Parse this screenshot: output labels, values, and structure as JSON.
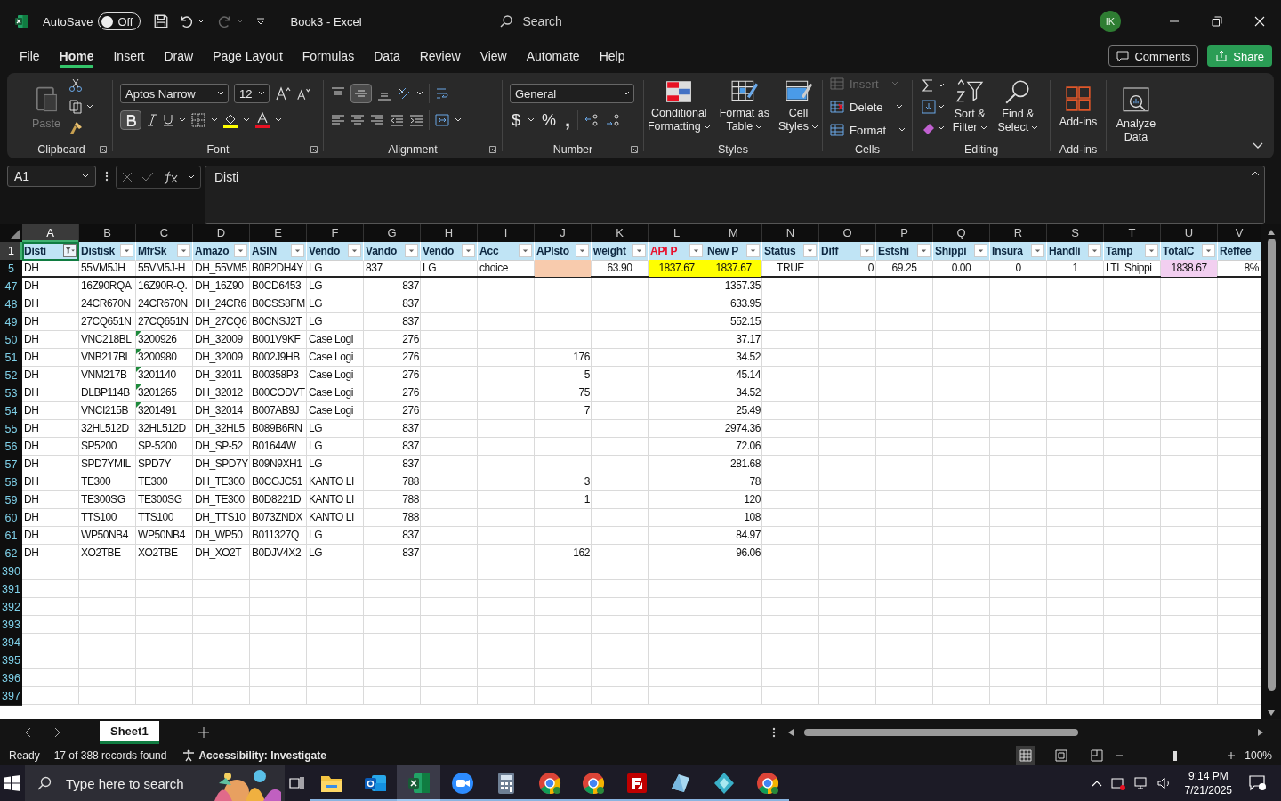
{
  "title_bar": {
    "autosave_label": "AutoSave",
    "autosave_on": false,
    "autosave_state": "Off",
    "title": "Book3 - Excel",
    "search_placeholder": "Search",
    "avatar": "IK"
  },
  "menu_tabs": [
    {
      "label": "File",
      "selected": false
    },
    {
      "label": "Home",
      "selected": true
    },
    {
      "label": "Insert",
      "selected": false
    },
    {
      "label": "Draw",
      "selected": false
    },
    {
      "label": "Page Layout",
      "selected": false
    },
    {
      "label": "Formulas",
      "selected": false
    },
    {
      "label": "Data",
      "selected": false
    },
    {
      "label": "Review",
      "selected": false
    },
    {
      "label": "View",
      "selected": false
    },
    {
      "label": "Automate",
      "selected": false
    },
    {
      "label": "Help",
      "selected": false
    }
  ],
  "comments": "Comments",
  "share": "Share",
  "ribbon": {
    "clipboard": {
      "label": "Clipboard",
      "paste": "Paste",
      "paste_disabled": true
    },
    "font": {
      "label": "Font",
      "family": "Aptos Narrow",
      "size": "12",
      "bold": true
    },
    "alignment": {
      "label": "Alignment",
      "middle_align": true
    },
    "number": {
      "label": "Number",
      "format": "General",
      "currency": "$",
      "percent": "%",
      "comma": ","
    },
    "styles": {
      "label": "Styles",
      "buttons": [
        {
          "lines": [
            "Conditional",
            "Formatting"
          ]
        },
        {
          "lines": [
            "Format as",
            "Table"
          ]
        },
        {
          "lines": [
            "Cell",
            "Styles"
          ]
        }
      ]
    },
    "cells": {
      "label": "Cells",
      "items": [
        {
          "label": "Insert",
          "disabled": true
        },
        {
          "label": "Delete",
          "disabled": false
        },
        {
          "label": "Format",
          "disabled": false
        }
      ]
    },
    "editing": {
      "label": "Editing",
      "buttons": [
        {
          "lines": [
            "Sort &",
            "Filter"
          ]
        },
        {
          "lines": [
            "Find &",
            "Select"
          ]
        }
      ]
    },
    "addins": {
      "label": "Add-ins",
      "button": "Add-ins"
    },
    "analyze": {
      "lines": [
        "Analyze",
        "Data"
      ]
    }
  },
  "formula_bar": {
    "name_box": "A1",
    "formula": "Disti"
  },
  "columns": [
    {
      "letter": "A",
      "selected": true
    },
    {
      "letter": "B",
      "selected": false
    },
    {
      "letter": "C",
      "selected": false
    },
    {
      "letter": "D",
      "selected": false
    },
    {
      "letter": "E",
      "selected": false
    },
    {
      "letter": "F",
      "selected": false
    },
    {
      "letter": "G",
      "selected": false
    },
    {
      "letter": "H",
      "selected": false
    },
    {
      "letter": "I",
      "selected": false
    },
    {
      "letter": "J",
      "selected": false
    },
    {
      "letter": "K",
      "selected": false
    },
    {
      "letter": "L",
      "selected": false
    },
    {
      "letter": "M",
      "selected": false
    },
    {
      "letter": "N",
      "selected": false
    },
    {
      "letter": "O",
      "selected": false
    },
    {
      "letter": "P",
      "selected": false
    },
    {
      "letter": "Q",
      "selected": false
    },
    {
      "letter": "R",
      "selected": false
    },
    {
      "letter": "S",
      "selected": false
    },
    {
      "letter": "T",
      "selected": false
    },
    {
      "letter": "U",
      "selected": false
    },
    {
      "letter": "V",
      "selected": false
    }
  ],
  "header_row": {
    "number": "1",
    "selected": true,
    "cells": [
      {
        "text": "Disti",
        "filter_button": true,
        "filtered": true,
        "active": true,
        "color": "#0e2841"
      },
      {
        "text": "Distisk",
        "filter_button": true,
        "filtered": false,
        "active": false,
        "color": "#0e2841"
      },
      {
        "text": "MfrSk",
        "filter_button": true,
        "filtered": false,
        "active": false,
        "color": "#0e2841"
      },
      {
        "text": "Amazo",
        "filter_button": true,
        "filtered": false,
        "active": false,
        "color": "#0e2841"
      },
      {
        "text": "ASIN",
        "filter_button": true,
        "filtered": false,
        "active": false,
        "color": "#0e2841"
      },
      {
        "text": "Vendo",
        "filter_button": true,
        "filtered": false,
        "active": false,
        "color": "#0e2841"
      },
      {
        "text": "Vando",
        "filter_button": true,
        "filtered": false,
        "active": false,
        "color": "#0e2841"
      },
      {
        "text": "Vendo",
        "filter_button": true,
        "filtered": false,
        "active": false,
        "color": "#0e2841"
      },
      {
        "text": "Acc",
        "filter_button": true,
        "filtered": false,
        "active": false,
        "color": "#0e2841"
      },
      {
        "text": "APIsto",
        "filter_button": true,
        "filtered": false,
        "active": false,
        "color": "#0e2841"
      },
      {
        "text": "weight",
        "filter_button": true,
        "filtered": false,
        "active": false,
        "color": "#0e2841"
      },
      {
        "text": "API P",
        "filter_button": true,
        "filtered": false,
        "active": false,
        "color": "#e8112d"
      },
      {
        "text": "New P",
        "filter_button": true,
        "filtered": false,
        "active": false,
        "color": "#0e2841"
      },
      {
        "text": "Status",
        "filter_button": true,
        "filtered": false,
        "active": false,
        "color": "#0e2841"
      },
      {
        "text": "Diff",
        "filter_button": true,
        "filtered": false,
        "active": false,
        "color": "#0e2841"
      },
      {
        "text": "Estshi",
        "filter_button": true,
        "filtered": false,
        "active": false,
        "color": "#0e2841"
      },
      {
        "text": "Shippi",
        "filter_button": true,
        "filtered": false,
        "active": false,
        "color": "#0e2841"
      },
      {
        "text": "Insura",
        "filter_button": true,
        "filtered": false,
        "active": false,
        "color": "#0e2841"
      },
      {
        "text": "Handli",
        "filter_button": true,
        "filtered": false,
        "active": false,
        "color": "#0e2841"
      },
      {
        "text": "Tamp",
        "filter_button": true,
        "filtered": false,
        "active": false,
        "color": "#0e2841"
      },
      {
        "text": "TotalC",
        "filter_button": true,
        "filtered": false,
        "active": false,
        "color": "#0e2841"
      },
      {
        "text": "Reffee",
        "filter_button": false,
        "active": false,
        "color": "#0e2841"
      }
    ]
  },
  "rows": [
    {
      "number": "5",
      "kind": "frozen",
      "flag": false,
      "cells": [
        {
          "text": "DH"
        },
        {
          "text": "55VM5JH"
        },
        {
          "text": "55VM5J-H"
        },
        {
          "text": "DH_55VM5"
        },
        {
          "text": "B0B2DH4Y"
        },
        {
          "text": "LG"
        },
        {
          "text": "837"
        },
        {
          "text": "LG"
        },
        {
          "text": "choice"
        },
        {
          "color": "#f8cbad"
        },
        {
          "text": "63.90"
        },
        {
          "text": "1837.67",
          "color": "#ffff00"
        },
        {
          "text": "1837.67",
          "color": "#ffff00"
        },
        {
          "text": "TRUE"
        },
        {
          "text": "0"
        },
        {
          "text": "69.25"
        },
        {
          "text": "0.00"
        },
        {
          "text": "0"
        },
        {
          "text": "1"
        },
        {
          "text": "LTL Shippi"
        },
        {
          "text": "1838.67",
          "color": "#f2cff0"
        },
        {
          "text": "8%"
        }
      ]
    },
    {
      "number": "47",
      "kind": "data",
      "flag": false,
      "cells": [
        "DH",
        "16Z90RQA",
        "16Z90R-Q.",
        "DH_16Z90",
        "B0CD6453",
        "LG",
        "837",
        null,
        null,
        null,
        null,
        null,
        "1357.35"
      ]
    },
    {
      "number": "48",
      "kind": "data",
      "flag": false,
      "cells": [
        "DH",
        "24CR670N",
        "24CR670N",
        "DH_24CR6",
        "B0CSS8FM",
        "LG",
        "837",
        null,
        null,
        null,
        null,
        null,
        "633.95"
      ]
    },
    {
      "number": "49",
      "kind": "data",
      "flag": false,
      "cells": [
        "DH",
        "27CQ651N",
        "27CQ651N",
        "DH_27CQ6",
        "B0CNSJ2T",
        "LG",
        "837",
        null,
        null,
        null,
        null,
        null,
        "552.15"
      ]
    },
    {
      "number": "50",
      "kind": "data",
      "flag": true,
      "cells": [
        "DH",
        "VNC218BL",
        "3200926",
        "DH_32009",
        "B001V9KF",
        "Case Logi",
        "276",
        null,
        null,
        null,
        null,
        null,
        "37.17"
      ]
    },
    {
      "number": "51",
      "kind": "data",
      "flag": true,
      "cells": [
        "DH",
        "VNB217BL",
        "3200980",
        "DH_32009",
        "B002J9HB",
        "Case Logi",
        "276",
        null,
        null,
        "176",
        null,
        null,
        "34.52"
      ]
    },
    {
      "number": "52",
      "kind": "data",
      "flag": true,
      "cells": [
        "DH",
        "VNM217B",
        "3201140",
        "DH_32011",
        "B00358P3",
        "Case Logi",
        "276",
        null,
        null,
        "5",
        null,
        null,
        "45.14"
      ]
    },
    {
      "number": "53",
      "kind": "data",
      "flag": true,
      "cells": [
        "DH",
        "DLBP114B",
        "3201265",
        "DH_32012",
        "B00CODVT",
        "Case Logi",
        "276",
        null,
        null,
        "75",
        null,
        null,
        "34.52"
      ]
    },
    {
      "number": "54",
      "kind": "data",
      "flag": true,
      "cells": [
        "DH",
        "VNCI215B",
        "3201491",
        "DH_32014",
        "B007AB9J",
        "Case Logi",
        "276",
        null,
        null,
        "7",
        null,
        null,
        "25.49"
      ]
    },
    {
      "number": "55",
      "kind": "data",
      "flag": false,
      "cells": [
        "DH",
        "32HL512D",
        "32HL512D",
        "DH_32HL5",
        "B089B6RN",
        "LG",
        "837",
        null,
        null,
        null,
        null,
        null,
        "2974.36"
      ]
    },
    {
      "number": "56",
      "kind": "data",
      "flag": false,
      "cells": [
        "DH",
        "SP5200",
        "SP-5200",
        "DH_SP-52",
        "B01644W",
        "LG",
        "837",
        null,
        null,
        null,
        null,
        null,
        "72.06"
      ]
    },
    {
      "number": "57",
      "kind": "data",
      "flag": false,
      "cells": [
        "DH",
        "SPD7YMIL",
        "SPD7Y",
        "DH_SPD7Y",
        "B09N9XH1",
        "LG",
        "837",
        null,
        null,
        null,
        null,
        null,
        "281.68"
      ]
    },
    {
      "number": "58",
      "kind": "data",
      "flag": false,
      "cells": [
        "DH",
        "TE300",
        "TE300",
        "DH_TE300",
        "B0CGJC51",
        "KANTO LI",
        "788",
        null,
        null,
        "3",
        null,
        null,
        "78"
      ]
    },
    {
      "number": "59",
      "kind": "data",
      "flag": false,
      "cells": [
        "DH",
        "TE300SG",
        "TE300SG",
        "DH_TE300",
        "B0D8221D",
        "KANTO LI",
        "788",
        null,
        null,
        "1",
        null,
        null,
        "120"
      ]
    },
    {
      "number": "60",
      "kind": "data",
      "flag": false,
      "cells": [
        "DH",
        "TTS100",
        "TTS100",
        "DH_TTS10",
        "B073ZNDX",
        "KANTO LI",
        "788",
        null,
        null,
        null,
        null,
        null,
        "108"
      ]
    },
    {
      "number": "61",
      "kind": "data",
      "flag": false,
      "cells": [
        "DH",
        "WP50NB4",
        "WP50NB4",
        "DH_WP50",
        "B011327Q",
        "LG",
        "837",
        null,
        null,
        null,
        null,
        null,
        "84.97"
      ]
    },
    {
      "number": "62",
      "kind": "data",
      "flag": false,
      "cells": [
        "DH",
        "XO2TBE",
        "XO2TBE",
        "DH_XO2T",
        "B0DJV4X2",
        "LG",
        "837",
        null,
        null,
        "162",
        null,
        null,
        "96.06"
      ]
    },
    {
      "number": "390",
      "kind": "data",
      "flag": false
    },
    {
      "number": "391",
      "kind": "data",
      "flag": false
    },
    {
      "number": "392",
      "kind": "data",
      "flag": false
    },
    {
      "number": "393",
      "kind": "data",
      "flag": false
    },
    {
      "number": "394",
      "kind": "data",
      "flag": false
    },
    {
      "number": "395",
      "kind": "data",
      "flag": false
    },
    {
      "number": "396",
      "kind": "data",
      "flag": false
    },
    {
      "number": "397",
      "kind": "data",
      "flag": false
    }
  ],
  "sheet_tabs": [
    {
      "label": "Sheet1",
      "selected": true
    }
  ],
  "status_bar": {
    "ready": "Ready",
    "records": "17 of 388 records found",
    "accessibility": "Accessibility: Investigate",
    "zoom": "100%",
    "zoom_slider": {
      "level": 0.5
    }
  },
  "taskbar": {
    "search_placeholder": "Type here to search",
    "apps": [
      {
        "kind": "folder",
        "selected": false
      },
      {
        "kind": "mail",
        "selected": false
      },
      {
        "kind": "sheet",
        "selected": true
      },
      {
        "kind": "video",
        "selected": false
      },
      {
        "kind": "calculator",
        "selected": false
      },
      {
        "kind": "browser",
        "selected": false
      },
      {
        "kind": "browser",
        "selected": false
      },
      {
        "kind": "transfer",
        "selected": false
      },
      {
        "kind": "crystal",
        "selected": false
      },
      {
        "kind": "diamond",
        "selected": false
      },
      {
        "kind": "browser",
        "selected": false
      }
    ],
    "time": "9:14 PM",
    "date": "7/21/2025"
  }
}
